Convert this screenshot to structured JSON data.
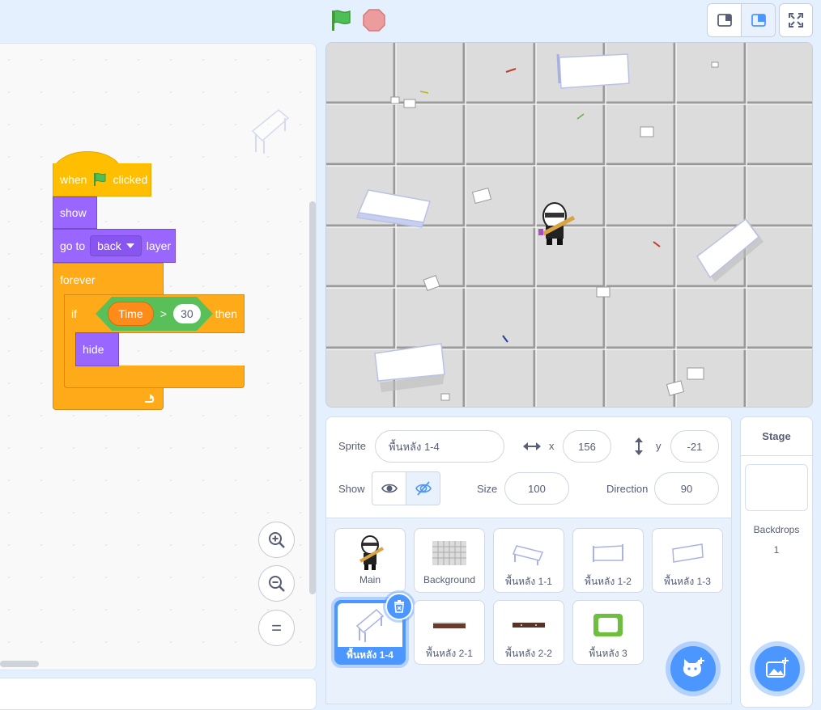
{
  "blocks": {
    "hat_when": "when",
    "hat_clicked": "clicked",
    "show": "show",
    "goto_prefix": "go to",
    "goto_option": "back",
    "goto_suffix": "layer",
    "forever": "forever",
    "if": "if",
    "then": "then",
    "variable": "Time",
    "operator": ">",
    "compare_value": "30",
    "hide": "hide"
  },
  "zoom": {
    "in": "+",
    "out": "−",
    "reset": "="
  },
  "sprite_info": {
    "sprite_label": "Sprite",
    "sprite_name": "พื้นหลัง 1-4",
    "x_label": "x",
    "x_value": "156",
    "y_label": "y",
    "y_value": "-21",
    "show_label": "Show",
    "size_label": "Size",
    "size_value": "100",
    "direction_label": "Direction",
    "direction_value": "90"
  },
  "sprites": [
    {
      "name": "Main"
    },
    {
      "name": "Background"
    },
    {
      "name": "พื้นหลัง 1-1"
    },
    {
      "name": "พื้นหลัง 1-2"
    },
    {
      "name": "พื้นหลัง 1-3"
    },
    {
      "name": "พื้นหลัง 1-4"
    },
    {
      "name": "พื้นหลัง 2-1"
    },
    {
      "name": "พื้นหลัง 2-2"
    },
    {
      "name": "พื้นหลัง 3"
    }
  ],
  "selected_sprite": "พื้นหลัง 1-4",
  "stage_panel": {
    "title": "Stage",
    "backdrops_label": "Backdrops",
    "backdrops_count": "1"
  },
  "colors": {
    "events": "#ffbf00",
    "looks": "#9966ff",
    "control": "#ffab19",
    "variables": "#ff8c1a",
    "operators": "#59c059",
    "accent": "#4c97ff"
  }
}
